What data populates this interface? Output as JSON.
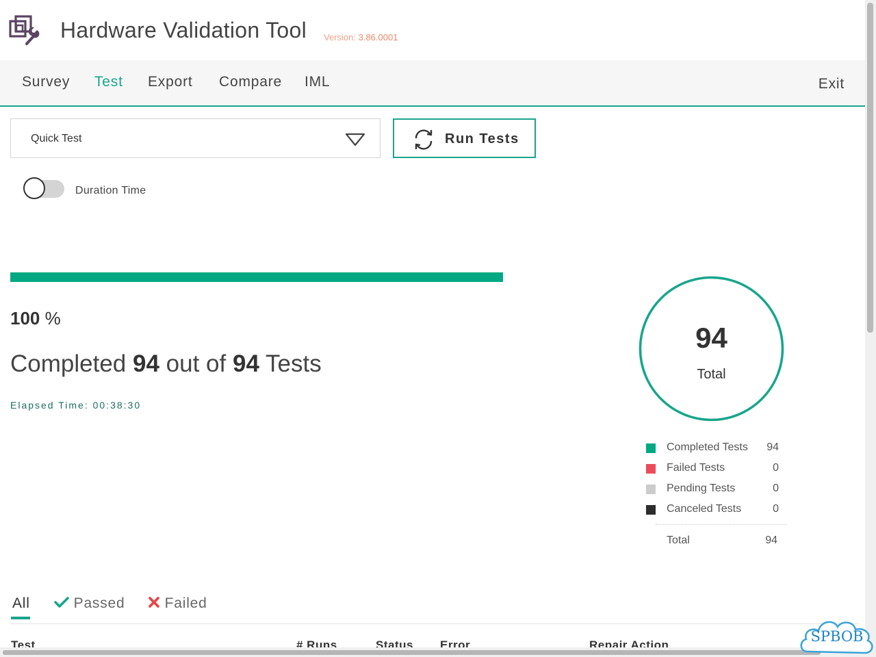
{
  "app": {
    "title": "Hardware Validation Tool",
    "version_label": "Version:",
    "version": "3.86.0001"
  },
  "nav": {
    "items": [
      {
        "label": "Survey"
      },
      {
        "label": "Test",
        "active": true
      },
      {
        "label": "Export"
      },
      {
        "label": "Compare"
      },
      {
        "label": "IML"
      }
    ],
    "exit_label": "Exit"
  },
  "test_select": {
    "selected": "Quick Test"
  },
  "run_button": {
    "label": "Run Tests"
  },
  "duration_toggle": {
    "label": "Duration Time",
    "on": false
  },
  "progress": {
    "percent": 100,
    "percent_sign": "%",
    "completed_prefix": "Completed",
    "completed": "94",
    "out_of": "out of",
    "total": "94",
    "tests_suffix": "Tests",
    "elapsed_label": "Elapsed Time:",
    "elapsed": "00:38:30"
  },
  "summary": {
    "total_value": "94",
    "total_label": "Total",
    "legend": [
      {
        "label": "Completed Tests",
        "value": "94",
        "color": "#01a982"
      },
      {
        "label": "Failed Tests",
        "value": "0",
        "color": "#ec4c5a"
      },
      {
        "label": "Pending Tests",
        "value": "0",
        "color": "#cccccc"
      },
      {
        "label": "Canceled Tests",
        "value": "0",
        "color": "#2d2d2d"
      }
    ],
    "legend_total_label": "Total",
    "legend_total_value": "94"
  },
  "filters": {
    "all": "All",
    "passed": "Passed",
    "failed": "Failed"
  },
  "table": {
    "columns": [
      "Test",
      "# Runs",
      "Status",
      "Error",
      "Repair Action"
    ]
  },
  "watermark": {
    "text": "SPBOB"
  },
  "colors": {
    "accent": "#19a58b",
    "progress": "#01a982",
    "fail": "#e24b4b"
  }
}
